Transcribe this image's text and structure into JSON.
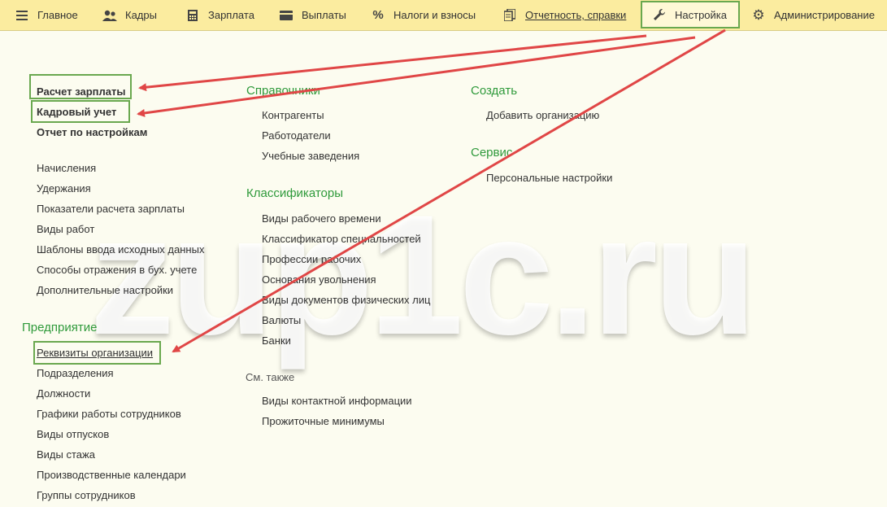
{
  "menu": {
    "main": "Главное",
    "staff": "Кадры",
    "salary": "Зарплата",
    "payments": "Выплаты",
    "taxes": "Налоги и взносы",
    "reports": "Отчетность, справки",
    "settings": "Настройка",
    "admin": "Администрирование",
    "active": "settings"
  },
  "col1": {
    "top": [
      "Расчет зарплаты",
      "Кадровый учет",
      "Отчет по настройкам"
    ],
    "list": [
      "Начисления",
      "Удержания",
      "Показатели расчета зарплаты",
      "Виды работ",
      "Шаблоны ввода исходных данных",
      "Способы отражения в бух. учете",
      "Дополнительные настройки"
    ],
    "enterprise_heading": "Предприятие",
    "enterprise": [
      "Реквизиты организации",
      "Подразделения",
      "Должности",
      "Графики работы сотрудников",
      "Виды отпусков",
      "Виды стажа",
      "Производственные календари",
      "Группы сотрудников"
    ]
  },
  "col2": {
    "refs_heading": "Справочники",
    "refs": [
      "Контрагенты",
      "Работодатели",
      "Учебные заведения"
    ],
    "class_heading": "Классификаторы",
    "class": [
      "Виды рабочего времени",
      "Классификатор специальностей",
      "Профессии рабочих",
      "Основания увольнения",
      "Виды документов физических лиц",
      "Валюты",
      "Банки"
    ],
    "see_also": "См. также",
    "also": [
      "Виды контактной информации",
      "Прожиточные минимумы"
    ]
  },
  "col3": {
    "create_heading": "Создать",
    "create": [
      "Добавить организацию"
    ],
    "service_heading": "Сервис",
    "service": [
      "Персональные настройки"
    ]
  },
  "watermark": "zup1c.ru",
  "colors": {
    "menu_bg": "#fbec9f",
    "content_bg": "#fcfcf0",
    "heading": "#2f9a3b",
    "highlight": "#6aa84f",
    "arrow": "#e04646"
  }
}
